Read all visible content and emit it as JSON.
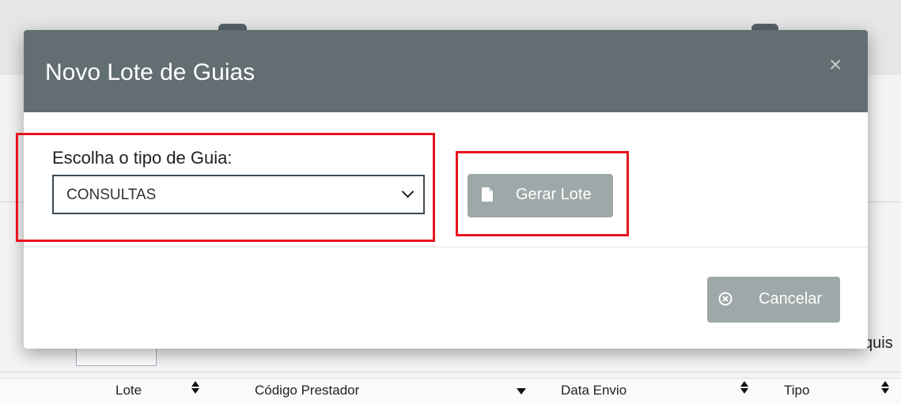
{
  "background": {
    "partial_right_text": "quis",
    "table_headers": [
      "Lote",
      "Código Prestador",
      "Data Envio",
      "Tipo"
    ]
  },
  "modal": {
    "title": "Novo Lote de Guias",
    "close_symbol": "×",
    "guide_type": {
      "label": "Escolha o tipo de Guia:",
      "selected": "CONSULTAS"
    },
    "generate_button": {
      "label": "Gerar Lote",
      "icon": "file-icon"
    },
    "cancel_button": {
      "label": "Cancelar",
      "icon": "x-circle-icon"
    },
    "highlight_color": "#e8141f"
  }
}
